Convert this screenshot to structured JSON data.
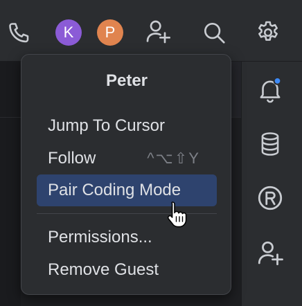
{
  "toolbar": {
    "call_icon": "phone-icon",
    "collaborators": [
      {
        "initial": "K",
        "color": "#8b5bd6"
      },
      {
        "initial": "P",
        "color": "#e0844f"
      }
    ],
    "invite_icon": "add-user-icon",
    "search_icon": "search-icon",
    "settings_icon": "gear-icon"
  },
  "popup": {
    "title": "Peter",
    "items": [
      {
        "label": "Jump To Cursor",
        "shortcut": ""
      },
      {
        "label": "Follow",
        "shortcut": "^⌥⇧Y"
      },
      {
        "label": "Pair Coding Mode",
        "shortcut": "",
        "selected": true
      },
      {
        "label": "Permissions...",
        "shortcut": ""
      },
      {
        "label": "Remove Guest",
        "shortcut": ""
      }
    ],
    "accent": "#2e436e"
  },
  "sidebar": {
    "items": [
      {
        "icon": "notifications-bell-icon",
        "badge_color": "#3d8af7"
      },
      {
        "icon": "database-icon"
      },
      {
        "icon": "r-console-icon"
      },
      {
        "icon": "add-user-icon"
      }
    ]
  }
}
